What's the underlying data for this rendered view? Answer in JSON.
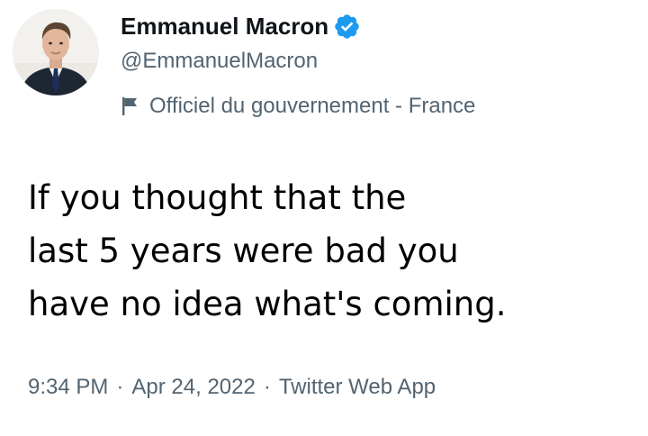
{
  "author": {
    "display_name": "Emmanuel Macron",
    "handle": "@EmmanuelMacron",
    "affiliation": "Officiel du gouvernement - France",
    "verified": true
  },
  "icons": {
    "avatar": "avatar",
    "verified": "verified-badge-icon",
    "affiliation": "flag-icon"
  },
  "colors": {
    "verified_blue": "#1d9bf0",
    "secondary_text": "#536471",
    "primary_text": "#0f1419"
  },
  "tweet": {
    "lines": [
      "If you thought that the",
      "last 5 years were bad you",
      "have no idea what's coming."
    ]
  },
  "meta": {
    "time": "9:34 PM",
    "separator": "·",
    "date": "Apr 24, 2022",
    "source": "Twitter Web App"
  }
}
